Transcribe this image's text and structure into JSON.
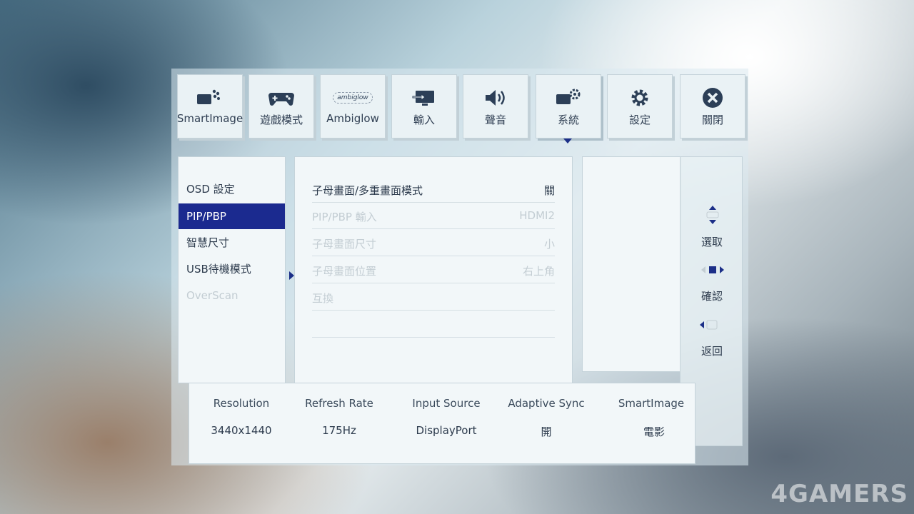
{
  "tabs": [
    {
      "label": "SmartImage",
      "icon": "smartimage-icon"
    },
    {
      "label": "遊戲模式",
      "icon": "gamepad-icon"
    },
    {
      "label": "Ambiglow",
      "icon": "ambiglow-icon",
      "icon_text": "ambiglow"
    },
    {
      "label": "輸入",
      "icon": "input-icon"
    },
    {
      "label": "聲音",
      "icon": "speaker-icon"
    },
    {
      "label": "系統",
      "icon": "system-icon",
      "active": true
    },
    {
      "label": "設定",
      "icon": "gear-icon"
    },
    {
      "label": "關閉",
      "icon": "close-icon"
    }
  ],
  "left_menu": [
    {
      "label": "OSD 設定"
    },
    {
      "label": "PIP/PBP",
      "selected": true
    },
    {
      "label": "智慧尺寸"
    },
    {
      "label": "USB待機模式"
    },
    {
      "label": "OverScan",
      "disabled": true
    }
  ],
  "settings": [
    {
      "label": "子母畫面/多重畫面模式",
      "value": "關"
    },
    {
      "label": "PIP/PBP 輸入",
      "value": "HDMI2",
      "disabled": true
    },
    {
      "label": "子母畫面尺寸",
      "value": "小",
      "disabled": true
    },
    {
      "label": "子母畫面位置",
      "value": "右上角",
      "disabled": true
    },
    {
      "label": "互換",
      "value": "",
      "disabled": true
    }
  ],
  "nav": {
    "select": "選取",
    "confirm": "確認",
    "back": "返回"
  },
  "status": {
    "headers": [
      "Resolution",
      "Refresh Rate",
      "Input Source",
      "Adaptive Sync",
      "SmartImage"
    ],
    "values": [
      "3440x1440",
      "175Hz",
      "DisplayPort",
      "開",
      "電影"
    ]
  },
  "watermark": "4GAMERS",
  "colors": {
    "selection": "#1b2a8f",
    "panel": "#f2f7f9",
    "text": "#2d3b4d",
    "disabled_text": "#c3cdd3"
  }
}
